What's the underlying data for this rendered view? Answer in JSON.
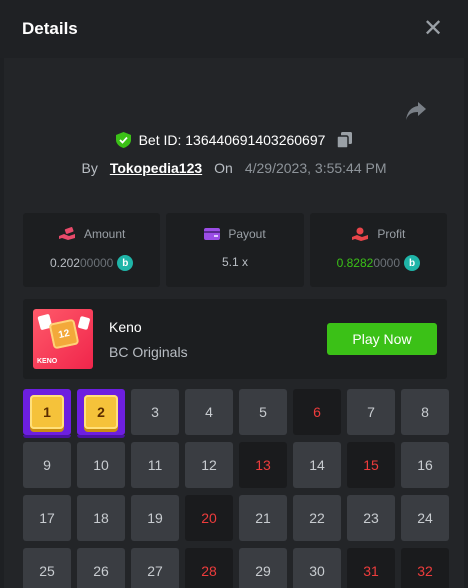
{
  "header": {
    "title": "Details",
    "close_glyph": "✕"
  },
  "bet": {
    "id_label": "Bet ID: 136440691403260697",
    "by_label": "By",
    "username": "Tokopedia123",
    "on_label": "On",
    "date": "4/29/2023, 3:55:44 PM"
  },
  "stats": {
    "amount": {
      "label": "Amount",
      "value_main": "0.202",
      "value_dim": "00000"
    },
    "payout": {
      "label": "Payout",
      "value": "5.1 x"
    },
    "profit": {
      "label": "Profit",
      "value_main": "0.8282",
      "value_dim": "0000"
    },
    "coin_letter": "b"
  },
  "game": {
    "thumb_number": "12",
    "thumb_label": "KENO",
    "name": "Keno",
    "provider": "BC Originals",
    "play_label": "Play Now"
  },
  "grid": {
    "cells": [
      {
        "n": "1",
        "state": "pick"
      },
      {
        "n": "2",
        "state": "pick"
      },
      {
        "n": "3",
        "state": "normal"
      },
      {
        "n": "4",
        "state": "normal"
      },
      {
        "n": "5",
        "state": "normal"
      },
      {
        "n": "6",
        "state": "drawn"
      },
      {
        "n": "7",
        "state": "normal"
      },
      {
        "n": "8",
        "state": "normal"
      },
      {
        "n": "9",
        "state": "normal"
      },
      {
        "n": "10",
        "state": "normal"
      },
      {
        "n": "11",
        "state": "normal"
      },
      {
        "n": "12",
        "state": "normal"
      },
      {
        "n": "13",
        "state": "drawn"
      },
      {
        "n": "14",
        "state": "normal"
      },
      {
        "n": "15",
        "state": "drawn"
      },
      {
        "n": "16",
        "state": "normal"
      },
      {
        "n": "17",
        "state": "normal"
      },
      {
        "n": "18",
        "state": "normal"
      },
      {
        "n": "19",
        "state": "normal"
      },
      {
        "n": "20",
        "state": "drawn"
      },
      {
        "n": "21",
        "state": "normal"
      },
      {
        "n": "22",
        "state": "normal"
      },
      {
        "n": "23",
        "state": "normal"
      },
      {
        "n": "24",
        "state": "normal"
      },
      {
        "n": "25",
        "state": "normal"
      },
      {
        "n": "26",
        "state": "normal"
      },
      {
        "n": "27",
        "state": "normal"
      },
      {
        "n": "28",
        "state": "drawn"
      },
      {
        "n": "29",
        "state": "normal"
      },
      {
        "n": "30",
        "state": "normal"
      },
      {
        "n": "31",
        "state": "drawn"
      },
      {
        "n": "32",
        "state": "drawn"
      }
    ]
  },
  "colors": {
    "accent_green": "#3bc117",
    "drawn_red": "#ed3c3c",
    "pick_purple": "#6d1fe0",
    "verified_green": "#3bc117"
  },
  "icons": {
    "close": "close-icon",
    "share": "share-icon",
    "verified": "shield-check-icon",
    "copy": "copy-icon",
    "amount": "hand-money-icon",
    "payout": "card-icon",
    "profit": "hand-coin-icon",
    "coin": "bc-coin-icon"
  }
}
